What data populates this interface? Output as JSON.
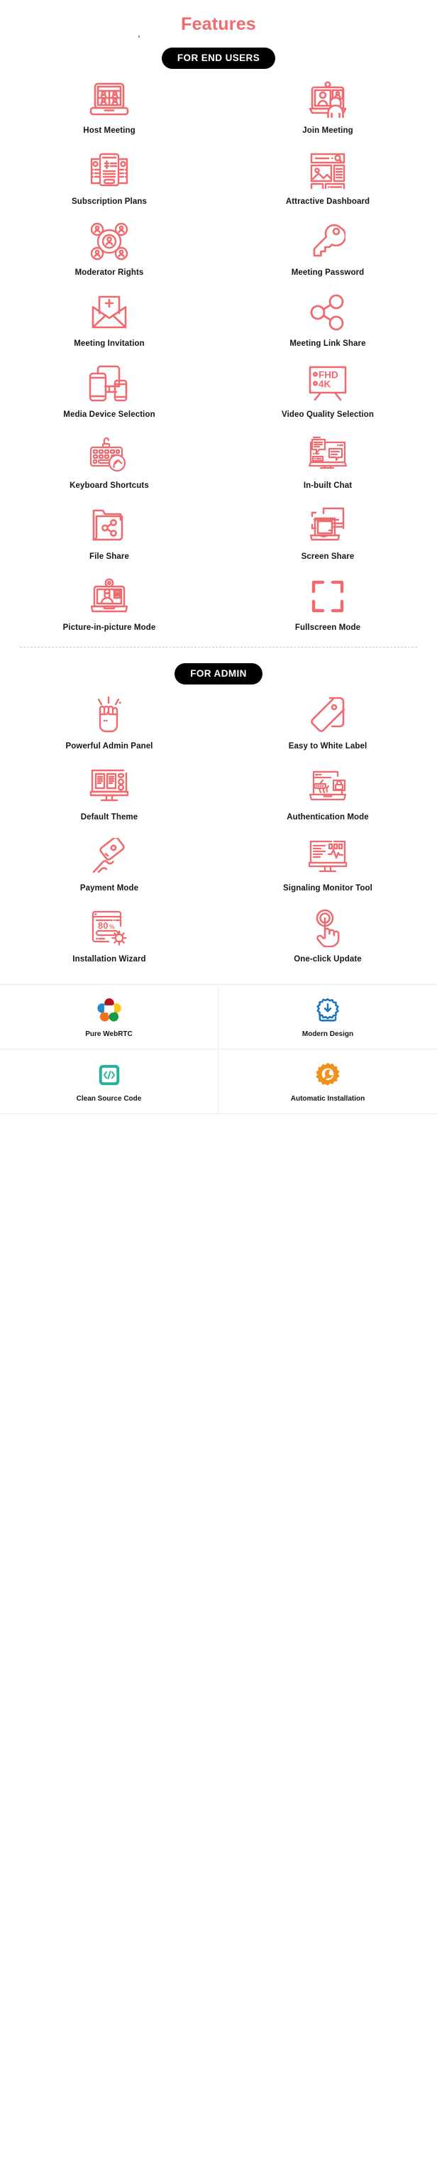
{
  "header": {
    "title": "Features",
    "accent_color": "#ee6a6e",
    "badge_end_users": "FOR END USERS",
    "badge_admin": "FOR ADMIN"
  },
  "end_user_features": [
    {
      "label": "Host Meeting",
      "icon": "laptop-grid-participants-icon"
    },
    {
      "label": "Join Meeting",
      "icon": "monitor-person-join-icon"
    },
    {
      "label": "Subscription Plans",
      "icon": "price-documents-dollar-icon"
    },
    {
      "label": "Attractive Dashboard",
      "icon": "dashboard-layout-icon"
    },
    {
      "label": "Moderator Rights",
      "icon": "users-network-icon"
    },
    {
      "label": "Meeting Password",
      "icon": "key-icon"
    },
    {
      "label": "Meeting Invitation",
      "icon": "envelope-plus-icon"
    },
    {
      "label": "Meeting Link Share",
      "icon": "share-nodes-icon"
    },
    {
      "label": "Media Device Selection",
      "icon": "multi-device-icon"
    },
    {
      "label": "Video Quality Selection",
      "icon": "tv-fhd-4k-icon"
    },
    {
      "label": "Keyboard Shortcuts",
      "icon": "keyboard-arrow-icon"
    },
    {
      "label": "In-built Chat",
      "icon": "monitor-chat-bubbles-icon"
    },
    {
      "label": "File Share",
      "icon": "folder-share-icon"
    },
    {
      "label": "Screen Share",
      "icon": "screen-share-icon"
    },
    {
      "label": "Picture-in-picture Mode",
      "icon": "laptop-pip-icon"
    },
    {
      "label": "Fullscreen Mode",
      "icon": "fullscreen-corners-icon"
    }
  ],
  "video_quality_labels": {
    "fhd": "FHD",
    "uhd": "4K"
  },
  "admin_features": [
    {
      "label": "Powerful Admin Panel",
      "icon": "raised-fist-icon"
    },
    {
      "label": "Easy to White Label",
      "icon": "price-tags-icon"
    },
    {
      "label": "Default Theme",
      "icon": "monitor-layout-theme-icon"
    },
    {
      "label": "Authentication Mode",
      "icon": "laptop-fingerprint-lock-icon"
    },
    {
      "label": "Payment Mode",
      "icon": "hand-credit-card-icon"
    },
    {
      "label": "Signaling Monitor Tool",
      "icon": "monitor-analytics-icon"
    },
    {
      "label": "Installation Wizard",
      "icon": "install-gear-icon"
    },
    {
      "label": "One-click Update",
      "icon": "hand-click-icon"
    }
  ],
  "installation_wizard_progress": "80%",
  "highlight_tiles": [
    {
      "label": "Pure WebRTC",
      "icon": "webrtc-logo-icon",
      "color": "#ea4335"
    },
    {
      "label": "Modern Design",
      "icon": "gear-download-icon",
      "color": "#1a73c0"
    },
    {
      "label": "Clean Source Code",
      "icon": "code-brackets-icon",
      "color": "#2ab09a"
    },
    {
      "label": "Automatic Installation",
      "icon": "gear-wrench-icon",
      "color": "#f1901b"
    }
  ]
}
